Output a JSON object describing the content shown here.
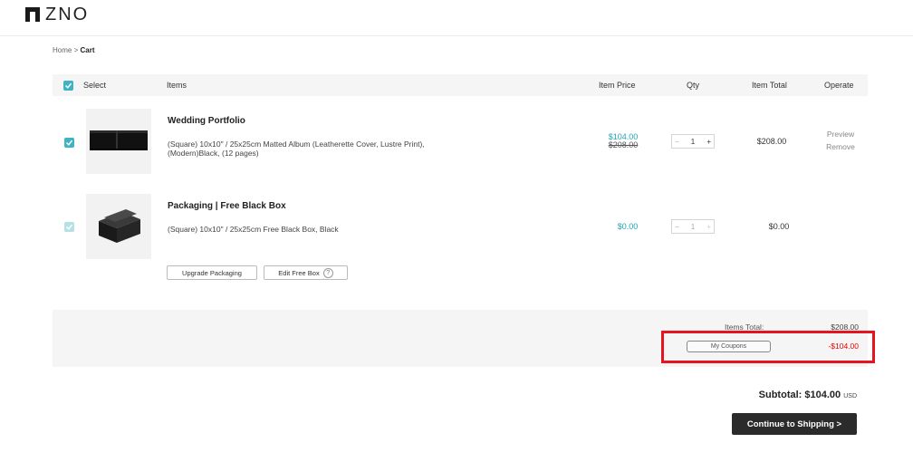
{
  "brand": {
    "logo_text": "ZNO"
  },
  "breadcrumb": {
    "home": "Home",
    "separator": ">",
    "current": "Cart"
  },
  "table_header": {
    "select": "Select",
    "items": "Items",
    "item_price": "Item Price",
    "qty": "Qty",
    "item_total": "Item Total",
    "operate": "Operate"
  },
  "items": [
    {
      "title": "Wedding Portfolio",
      "description_line1": "(Square) 10x10\" / 25x25cm Matted Album (Leatherette Cover, Lustre Print),",
      "description_line2": "(Modern)Black, (12 pages)",
      "price_now": "$104.00",
      "price_was": "$208.00",
      "qty": "1",
      "item_total": "$208.00",
      "preview": "Preview",
      "remove": "Remove",
      "selected": true
    },
    {
      "title": "Packaging | Free Black Box",
      "description_line1": "(Square) 10x10\" / 25x25cm Free Black Box, Black",
      "price_now": "$0.00",
      "qty": "1",
      "item_total": "$0.00",
      "upgrade_label": "Upgrade Packaging",
      "edit_label": "Edit Free Box",
      "selected": true,
      "disabled": true
    }
  ],
  "summary": {
    "items_total_label": "Items Total:",
    "items_total_value": "$208.00",
    "coupons_label": "My Coupons",
    "discount_value": "-$104.00"
  },
  "subtotal": {
    "label": "Subtotal:",
    "value": "$104.00",
    "currency": "USD"
  },
  "continue_label": "Continue to Shipping >",
  "colors": {
    "accent": "#3fb3c1",
    "price": "#22a6b4",
    "discount": "#e00000",
    "highlight": "#e6141e",
    "button": "#2b2b2b"
  }
}
